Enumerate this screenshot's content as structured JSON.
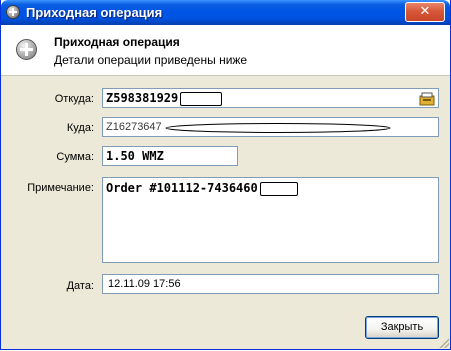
{
  "window": {
    "title": "Приходная операция",
    "close_glyph": "✕"
  },
  "header": {
    "title": "Приходная операция",
    "subtitle": "Детали операции приведены ниже"
  },
  "fields": {
    "from": {
      "label": "Откуда:",
      "value": "Z598381929"
    },
    "to": {
      "label": "Куда:",
      "value": "Z16273647"
    },
    "amount": {
      "label": "Сумма:",
      "value": "1.50 WMZ"
    },
    "note": {
      "label": "Примечание:",
      "value": "Order #101112-7436460"
    },
    "date": {
      "label": "Дата:",
      "value": "12.11.09 17:56"
    }
  },
  "buttons": {
    "close_label": "Закрыть"
  },
  "icons": {
    "title_icon": "plus-circle-icon",
    "header_icon": "plus-circle-icon",
    "from_field_icon": "wallet-icon"
  },
  "colors": {
    "titlebar": "#0054e3",
    "dialog_bg": "#ece9d8",
    "field_border": "#7f9db9"
  }
}
